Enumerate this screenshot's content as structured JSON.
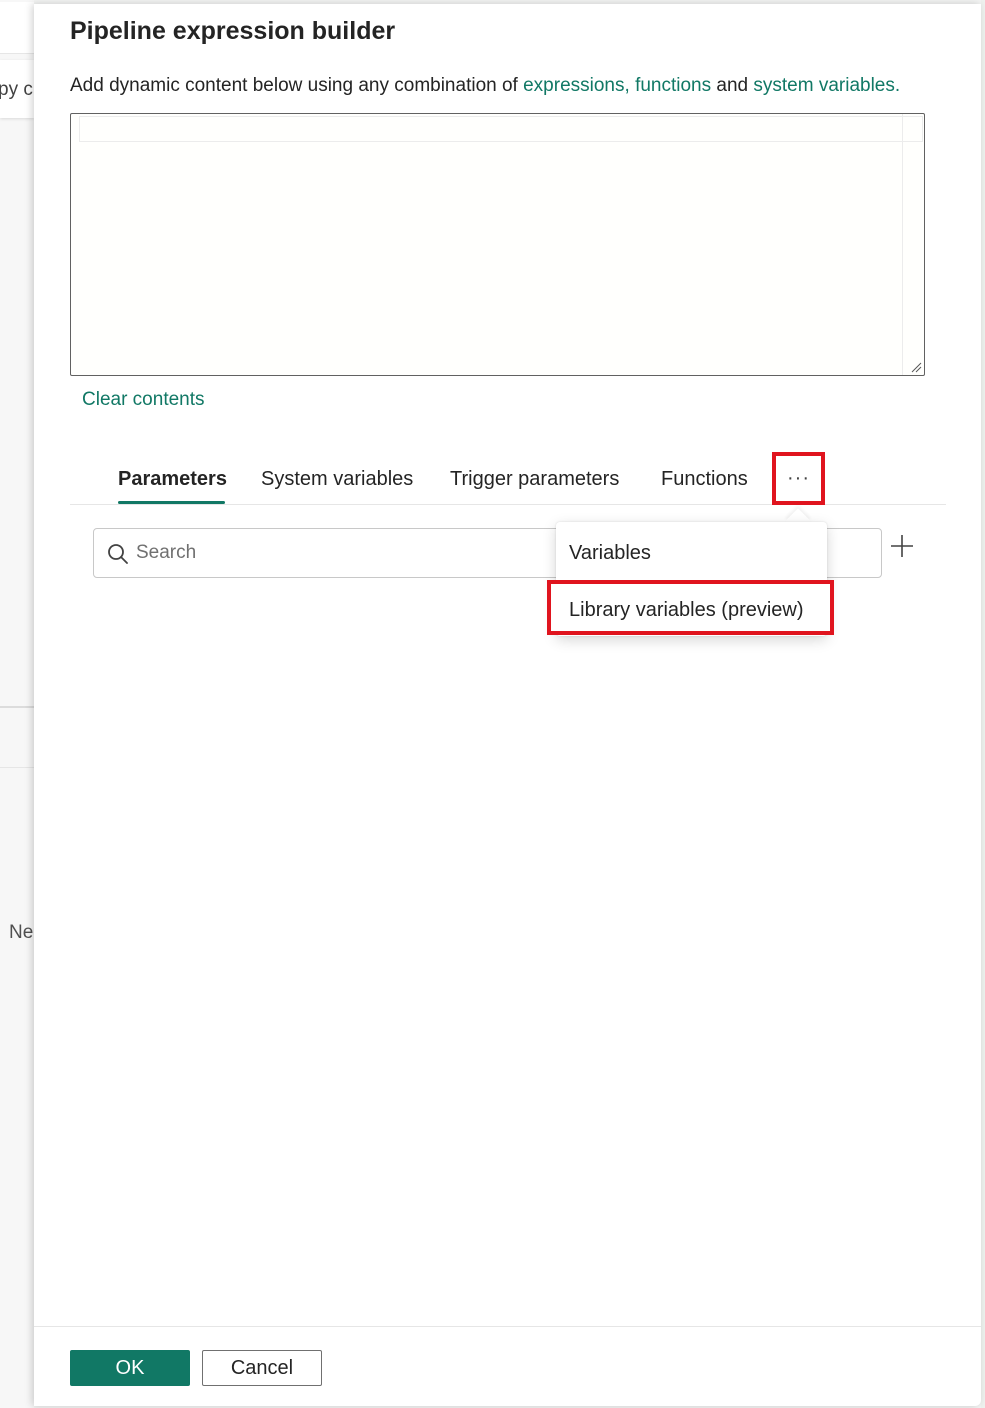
{
  "background": {
    "card_text": "py c",
    "side_text": "Ne"
  },
  "dialog": {
    "title": "Pipeline expression builder",
    "description": {
      "prefix": "Add dynamic content below using any combination of ",
      "link_expressions": "expressions,",
      "link_functions": "functions",
      "middle": " and ",
      "link_system_variables": "system variables."
    },
    "editor_value": "",
    "clear_contents": "Clear contents",
    "tabs": [
      {
        "label": "Parameters",
        "active": true
      },
      {
        "label": "System variables",
        "active": false
      },
      {
        "label": "Trigger parameters",
        "active": false
      },
      {
        "label": "Functions",
        "active": false
      }
    ],
    "more_label": "···",
    "search": {
      "placeholder": "Search",
      "value": ""
    },
    "menu_items": [
      {
        "label": "Variables"
      },
      {
        "label": "Library variables (preview)",
        "highlighted": true
      }
    ],
    "ok_label": "OK",
    "cancel_label": "Cancel"
  },
  "colors": {
    "accent": "#117865",
    "highlight": "#e0141e"
  },
  "icons": {
    "search": "search-icon",
    "add": "add-icon",
    "more": "more-horizontal-icon",
    "resize": "resize-handle-icon"
  }
}
